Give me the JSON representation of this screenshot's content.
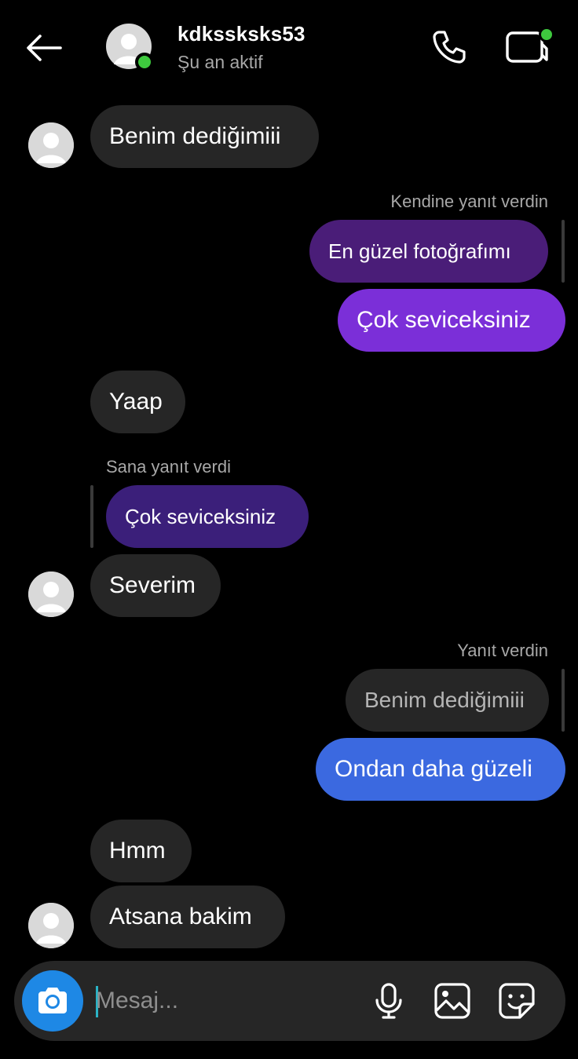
{
  "header": {
    "username": "kdkssksks53",
    "status": "Şu an aktif"
  },
  "messages": {
    "m1": "Benim dediğimiii",
    "label_self_reply": "Kendine yanıt verdin",
    "m2_quoted": "En güzel fotoğrafımı",
    "m3": "Çok seviceksiniz",
    "m4": "Yaap",
    "label_they_replied": "Sana yanıt verdi",
    "m5_quoted": "Çok seviceksiniz",
    "m6": "Severim",
    "label_you_replied": "Yanıt verdin",
    "m7_quoted": "Benim dediğimiii",
    "m8": "Ondan daha güzeli",
    "m9": "Hmm",
    "m10": "Atsana bakim"
  },
  "composer": {
    "placeholder": "Mesaj..."
  },
  "colors": {
    "background": "#000000",
    "incoming_bubble": "#262626",
    "outgoing_purple": "#7b2fd8",
    "outgoing_purple_dark": "#4a1d78",
    "outgoing_blue": "#3b69e0",
    "online": "#3ec93e",
    "camera_button": "#1e88e5"
  },
  "icons": [
    "back-arrow-icon",
    "phone-icon",
    "video-call-icon",
    "camera-icon",
    "microphone-icon",
    "gallery-icon",
    "sticker-icon"
  ]
}
